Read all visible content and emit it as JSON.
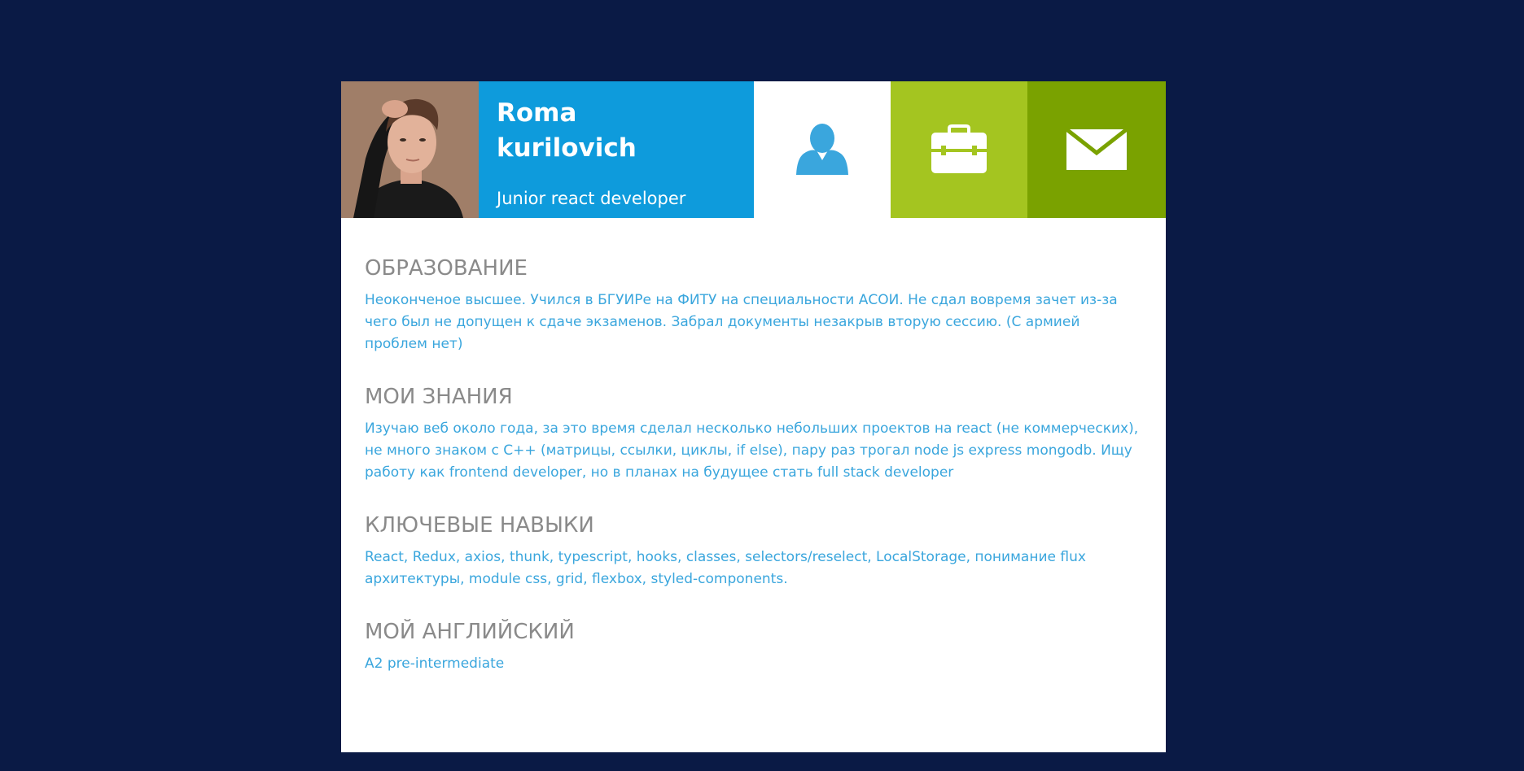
{
  "profile": {
    "name": "Roma\nkurilovich",
    "role": "Junior react developer"
  },
  "tiles": {
    "about_icon": "person-icon",
    "work_icon": "briefcase-icon",
    "contact_icon": "envelope-icon"
  },
  "colors": {
    "background": "#0a1a45",
    "blue": "#0e9bdc",
    "lime": "#a4c520",
    "green": "#7aa200",
    "heading": "#8a8a8a",
    "text": "#3aa6dd"
  },
  "sections": [
    {
      "title": "ОБРАЗОВАНИЕ",
      "text": "Неоконченое высшее. Учился в БГУИРе на ФИТУ на специальности АСОИ. Не сдал вовремя зачет из-за чего был не допущен к сдаче экзаменов. Забрал документы незакрыв вторую сессию. (С армией проблем нет)"
    },
    {
      "title": "МОИ ЗНАНИЯ",
      "text": "Изучаю веб около года, за это время сделал несколько небольших проектов на react (не коммерческих), не много знаком с C++ (матрицы, ссылки, циклы, if else), пару раз трогал node js express mongodb. Ищу работу как frontend developer, но в планах на будущее стать full stack developer"
    },
    {
      "title": "КЛЮЧЕВЫЕ НАВЫКИ",
      "text": "React, Redux, axios, thunk, typescript, hooks, classes, selectors/reselect, LocalStorage, понимание flux архитектуры, module css, grid, flexbox, styled-components."
    },
    {
      "title": "МОЙ АНГЛИЙСКИЙ",
      "text": "A2 pre-intermediate"
    }
  ]
}
